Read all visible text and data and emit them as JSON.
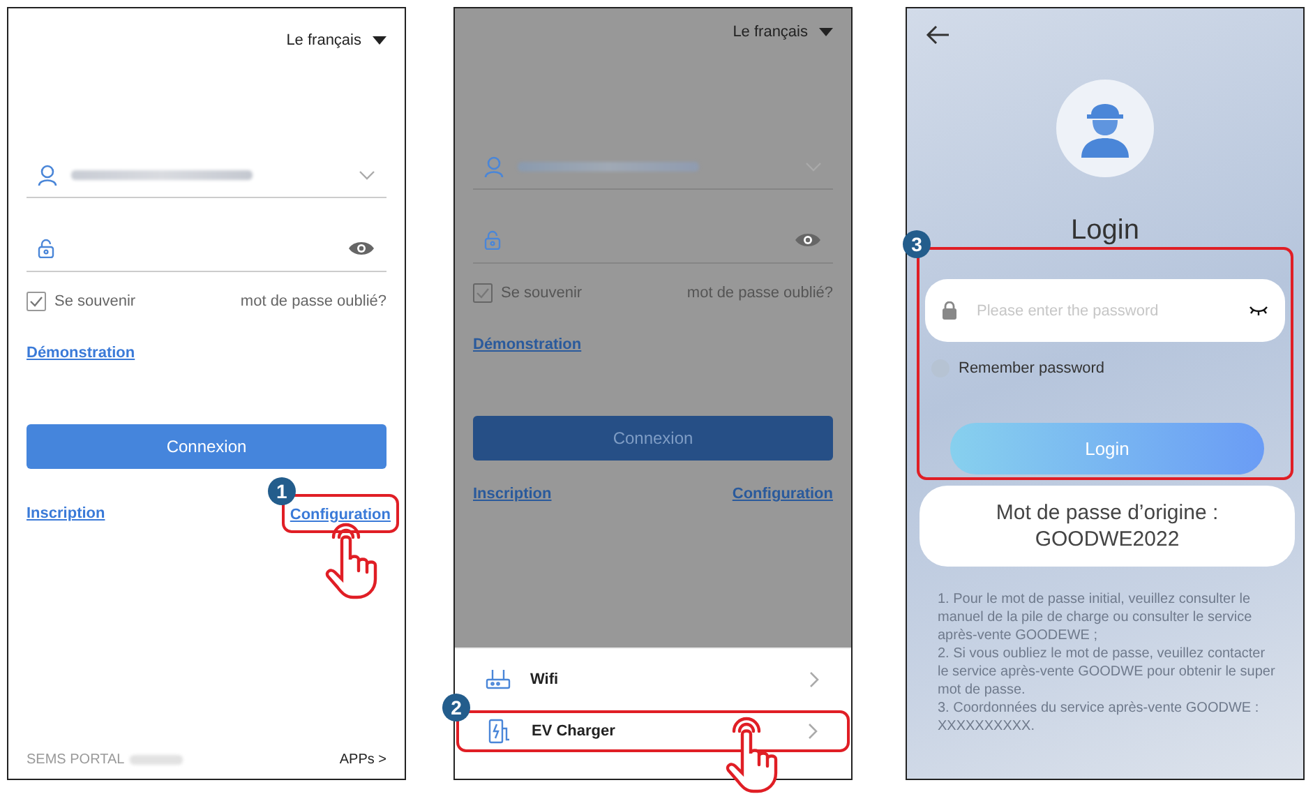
{
  "panels": [
    {
      "kind": "login",
      "dimmed": false,
      "language": "Le français",
      "remember": {
        "label": "Se souvenir",
        "checked": true
      },
      "forgot": "mot de passe oublié?",
      "demo_link": "Démonstration",
      "login_button": "Connexion",
      "bottom_links": [
        {
          "label": "Inscription"
        },
        {
          "label": "Configuration",
          "callout": {
            "number": "1",
            "hand": true
          }
        }
      ],
      "footer": {
        "brand": "SEMS PORTAL",
        "apps": "APPs >"
      }
    },
    {
      "kind": "login",
      "dimmed": true,
      "language": "Le français",
      "remember": {
        "label": "Se souvenir",
        "checked": true
      },
      "forgot": "mot de passe oublié?",
      "demo_link": "Démonstration",
      "login_button": "Connexion",
      "bottom_links": [
        {
          "label": "Inscription"
        },
        {
          "label": "Configuration"
        }
      ],
      "sheet": [
        {
          "kind": "wifi",
          "label": "Wifi"
        },
        {
          "kind": "charger",
          "label": "EV Charger",
          "callout": {
            "number": "2",
            "hand": true
          }
        }
      ]
    },
    {
      "kind": "password",
      "title": "Login",
      "form": {
        "placeholder": "Please enter the password",
        "remember": {
          "label": "Remember password",
          "checked": false
        },
        "login_button": "Login",
        "callout": {
          "number": "3",
          "hand": false
        }
      },
      "default_password": {
        "label": "Mot de passe d’origine :",
        "value": "GOODWE2022"
      },
      "notes": [
        "1. Pour le mot de passe initial, veuillez consulter le manuel de la pile de charge ou consulter le service après-vente GOODEWE ;",
        "2. Si vous oubliez le mot de passe, veuillez contacter le service après-vente GOODWE pour obtenir le super mot de passe.",
        "3. Coordonnées du service après-vente GOODWE : XXXXXXXXXX."
      ]
    }
  ]
}
